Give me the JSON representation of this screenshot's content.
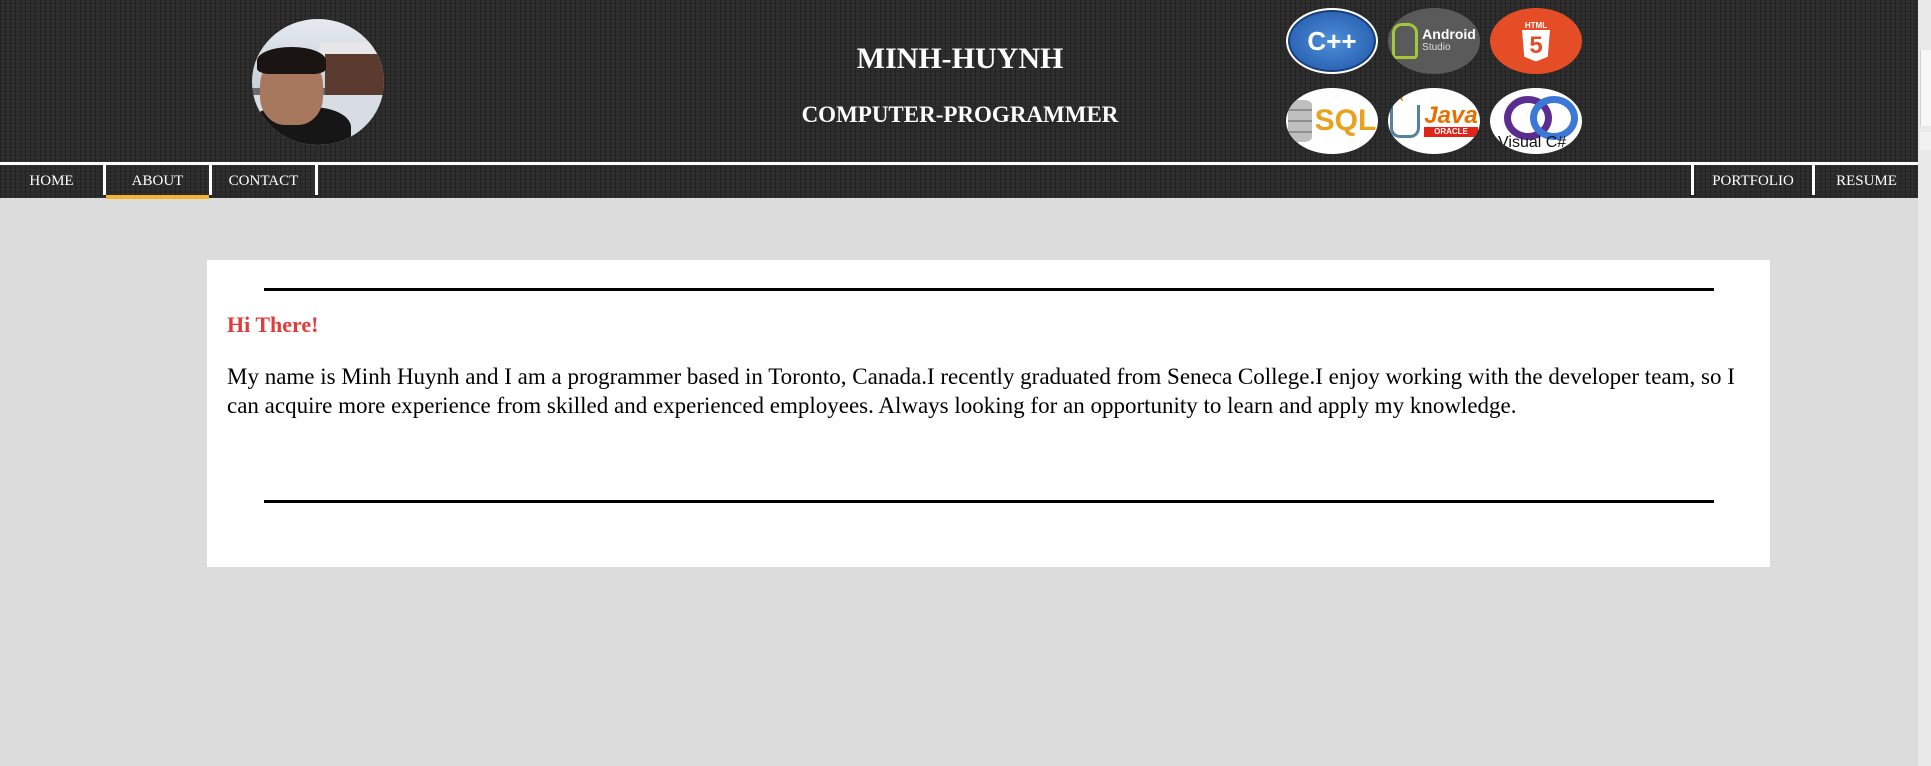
{
  "header": {
    "name": "MINH-HUYNH",
    "role": "COMPUTER-PROGRAMMER",
    "logos": {
      "cpp": "C++",
      "android_title": "Android",
      "android_sub": "Studio",
      "html5_tag": "HTML",
      "html5_num": "5",
      "sql": "SQL",
      "java": "Java",
      "java_sub": "ORACLE",
      "vcs": "Visual C#"
    }
  },
  "nav": {
    "home": "HOME",
    "about": "ABOUT",
    "contact": "CONTACT",
    "portfolio": "PORTFOLIO",
    "resume": "RESUME",
    "active": "ABOUT",
    "active_color": "#f2b52b"
  },
  "about": {
    "greeting": "Hi There!",
    "bio": "My name is Minh Huynh and I am a programmer based in Toronto, Canada.I recently graduated from Seneca College.I enjoy working with the developer team, so I can acquire more experience from skilled and experienced employees. Always looking for an opportunity to learn and apply my knowledge."
  },
  "colors": {
    "header_bg": "#2b2b2b",
    "page_bg": "#dcdcdc",
    "greeting": "#e13c3c"
  }
}
